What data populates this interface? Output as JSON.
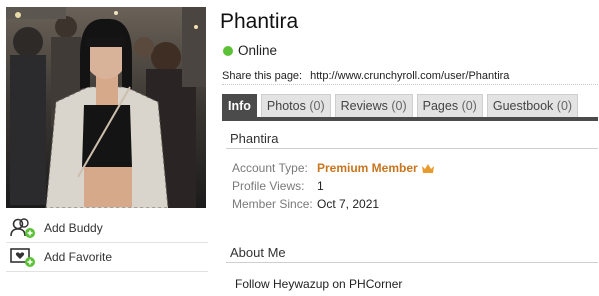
{
  "profile": {
    "name": "Phantira",
    "status": "Online",
    "status_color": "#5cc137",
    "share_label": "Share this page:",
    "share_url": "http://www.crunchyroll.com/user/Phantira"
  },
  "sidebar": {
    "actions": [
      {
        "label": "Add Buddy",
        "icon": "add-buddy-icon"
      },
      {
        "label": "Add Favorite",
        "icon": "add-favorite-icon"
      }
    ]
  },
  "tabs": [
    {
      "label": "Info",
      "count": "",
      "active": true
    },
    {
      "label": "Photos",
      "count": "(0)"
    },
    {
      "label": "Reviews",
      "count": "(0)"
    },
    {
      "label": "Pages",
      "count": "(0)"
    },
    {
      "label": "Guestbook",
      "count": "(0)"
    }
  ],
  "info": {
    "heading": "Phantira",
    "rows": [
      {
        "key": "Account Type:",
        "value": "Premium Member"
      },
      {
        "key": "Profile Views:",
        "value": "1"
      },
      {
        "key": "Member Since:",
        "value": "Oct 7, 2021"
      }
    ],
    "premium_color": "#c8751e"
  },
  "about": {
    "heading": "About Me",
    "text": "Follow Heywazup on PHCorner"
  },
  "colors": {
    "active_tab": "#4b4b4b",
    "accent": "#5cc137"
  }
}
